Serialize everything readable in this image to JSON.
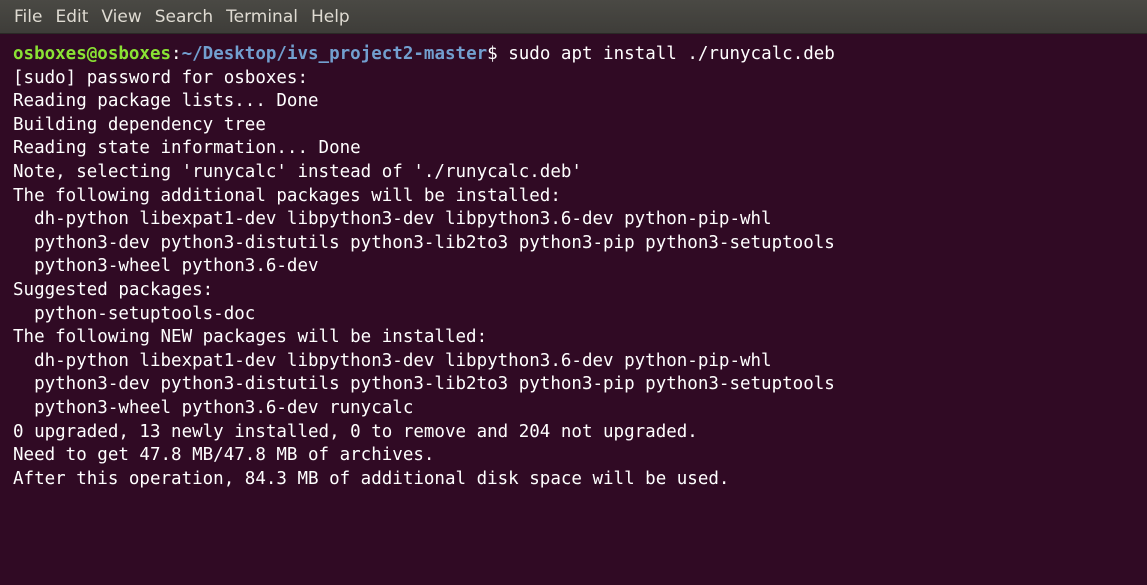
{
  "menu": {
    "items": [
      "File",
      "Edit",
      "View",
      "Search",
      "Terminal",
      "Help"
    ]
  },
  "prompt": {
    "user_host": "osboxes@osboxes",
    "colon": ":",
    "path": "~/Desktop/ivs_project2-master",
    "symbol": "$",
    "command": " sudo apt install ./runycalc.deb"
  },
  "output_lines": [
    "[sudo] password for osboxes:",
    "Reading package lists... Done",
    "Building dependency tree",
    "Reading state information... Done",
    "Note, selecting 'runycalc' instead of './runycalc.deb'",
    "The following additional packages will be installed:",
    "  dh-python libexpat1-dev libpython3-dev libpython3.6-dev python-pip-whl",
    "  python3-dev python3-distutils python3-lib2to3 python3-pip python3-setuptools",
    "  python3-wheel python3.6-dev",
    "Suggested packages:",
    "  python-setuptools-doc",
    "The following NEW packages will be installed:",
    "  dh-python libexpat1-dev libpython3-dev libpython3.6-dev python-pip-whl",
    "  python3-dev python3-distutils python3-lib2to3 python3-pip python3-setuptools",
    "  python3-wheel python3.6-dev runycalc",
    "0 upgraded, 13 newly installed, 0 to remove and 204 not upgraded.",
    "Need to get 47.8 MB/47.8 MB of archives.",
    "After this operation, 84.3 MB of additional disk space will be used."
  ]
}
